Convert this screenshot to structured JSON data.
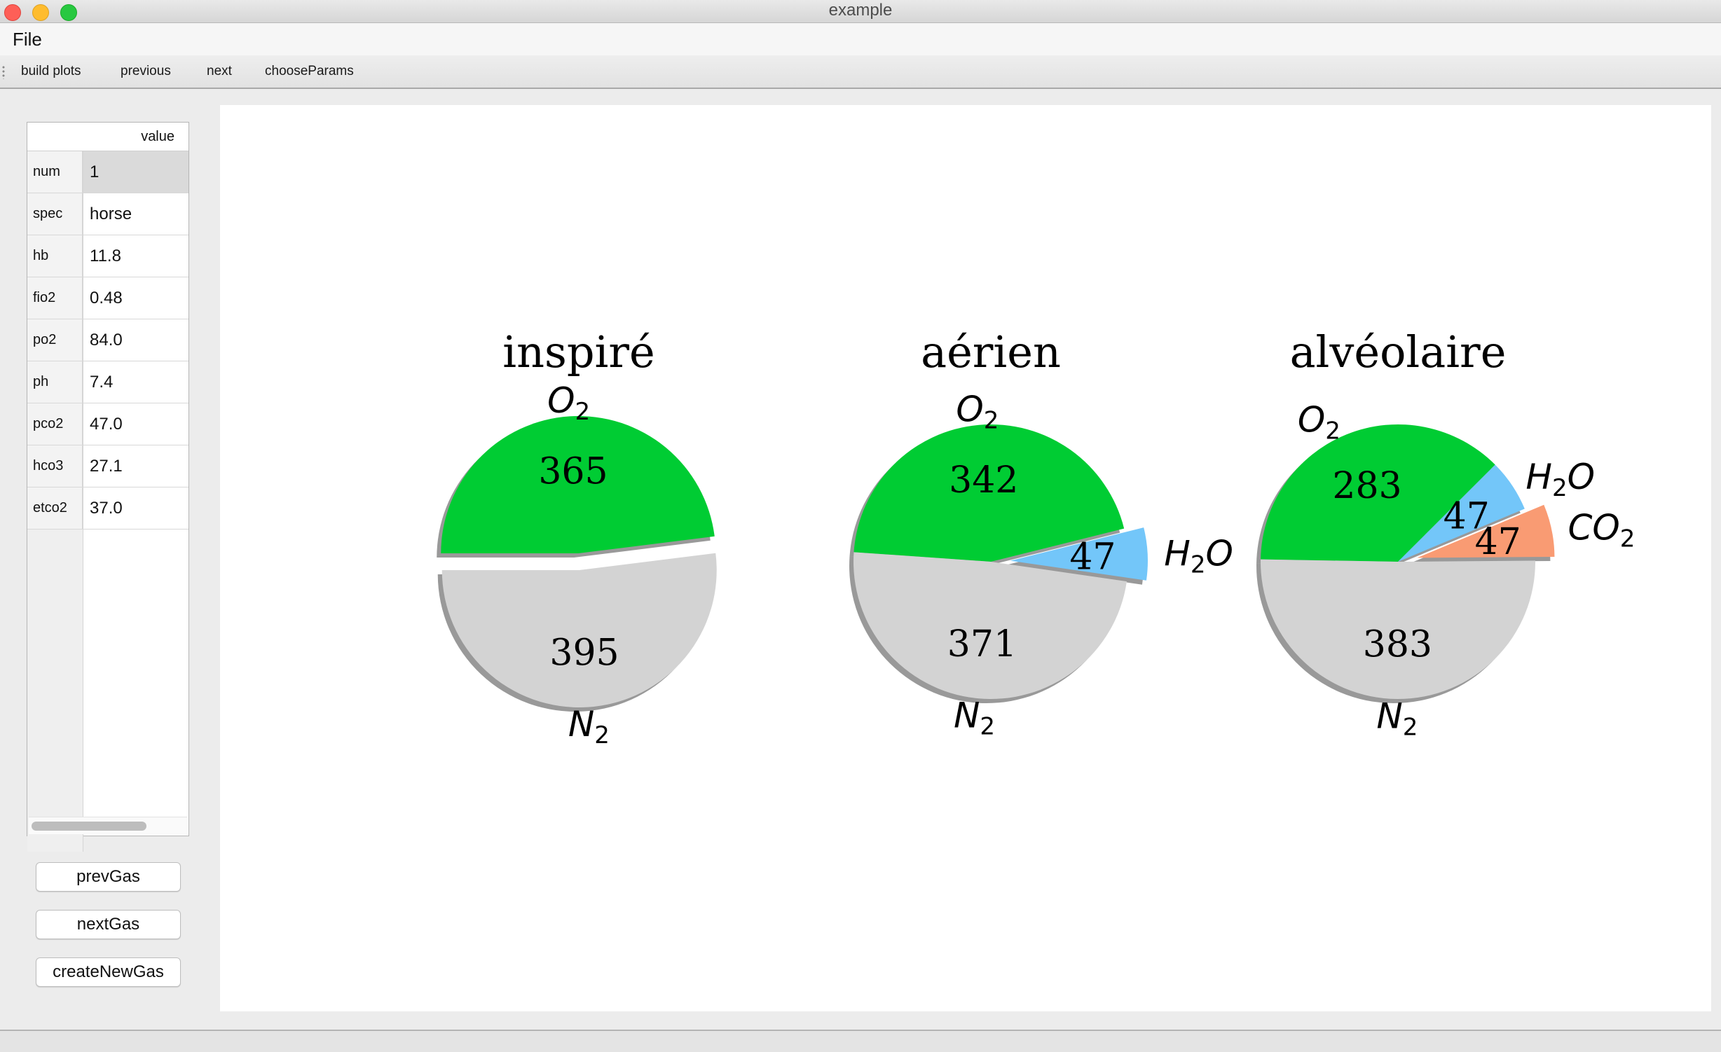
{
  "window": {
    "title": "example"
  },
  "menu": {
    "file": "File"
  },
  "toolbar": {
    "build_plots": "build plots",
    "previous": "previous",
    "next": "next",
    "choose_params": "chooseParams"
  },
  "table": {
    "header": "value",
    "rows": [
      {
        "key": "num",
        "value": "1"
      },
      {
        "key": "spec",
        "value": "horse"
      },
      {
        "key": "hb",
        "value": "11.8"
      },
      {
        "key": "fio2",
        "value": "0.48"
      },
      {
        "key": "po2",
        "value": "84.0"
      },
      {
        "key": "ph",
        "value": "7.4"
      },
      {
        "key": "pco2",
        "value": "47.0"
      },
      {
        "key": "hco3",
        "value": "27.1"
      },
      {
        "key": "etco2",
        "value": "37.0"
      }
    ]
  },
  "buttons": {
    "prev_gas": "prevGas",
    "next_gas": "nextGas",
    "create_new_gas": "createNewGas"
  },
  "colors": {
    "o2": "#00cc33",
    "n2": "#d3d3d3",
    "h2o": "#73c6f9",
    "co2": "#f99b73"
  },
  "chart_data": [
    {
      "type": "pie",
      "title": "inspiré",
      "slices": [
        {
          "label": "O",
          "sub": "2",
          "value": 365,
          "value_label": "365",
          "color": "#00cc33"
        },
        {
          "label": "N",
          "sub": "2",
          "value": 395,
          "value_label": "395",
          "color": "#d3d3d3"
        }
      ]
    },
    {
      "type": "pie",
      "title": "aérien",
      "slices": [
        {
          "label": "O",
          "sub": "2",
          "value": 342,
          "value_label": "342",
          "color": "#00cc33"
        },
        {
          "label": "H",
          "sub": "2",
          "suffix": "O",
          "value": 47,
          "value_label": "47",
          "color": "#73c6f9"
        },
        {
          "label": "N",
          "sub": "2",
          "value": 371,
          "value_label": "371",
          "color": "#d3d3d3"
        }
      ]
    },
    {
      "type": "pie",
      "title": "alvéolaire",
      "slices": [
        {
          "label": "O",
          "sub": "2",
          "value": 283,
          "value_label": "283",
          "color": "#00cc33"
        },
        {
          "label": "H",
          "sub": "2",
          "suffix": "O",
          "value": 47,
          "value_label": "47",
          "color": "#73c6f9"
        },
        {
          "label": "CO",
          "sub": "2",
          "value": 47,
          "value_label": "47",
          "color": "#f99b73"
        },
        {
          "label": "N",
          "sub": "2",
          "value": 383,
          "value_label": "383",
          "color": "#d3d3d3"
        }
      ]
    }
  ]
}
